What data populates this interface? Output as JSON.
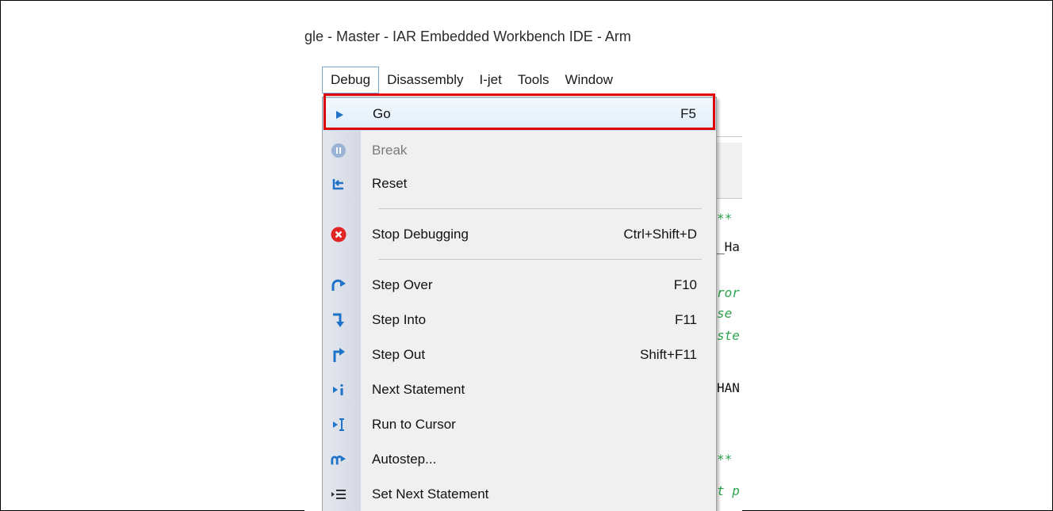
{
  "window": {
    "title": "gle - Master - IAR Embedded Workbench IDE - Arm"
  },
  "menubar": {
    "items": [
      {
        "label": "Debug",
        "active": true
      },
      {
        "label": "Disassembly"
      },
      {
        "label": "I-jet"
      },
      {
        "label": "Tools"
      },
      {
        "label": "Window"
      }
    ]
  },
  "editor_fragments": {
    "f1": "**",
    "f2": "_Ha",
    "f3": "ror",
    "f4": "se",
    "f5": "ste",
    "f6": "HAN",
    "f7": "**",
    "f8": "t p"
  },
  "debug_menu": {
    "go": {
      "label": "Go",
      "shortcut": "F5",
      "icon": "play-icon"
    },
    "break": {
      "label": "Break",
      "icon": "pause-icon"
    },
    "reset": {
      "label": "Reset",
      "icon": "reset-icon"
    },
    "stop": {
      "label": "Stop Debugging",
      "shortcut": "Ctrl+Shift+D",
      "icon": "stop-icon"
    },
    "step_over": {
      "label": "Step Over",
      "shortcut": "F10",
      "icon": "step-over-icon"
    },
    "step_into": {
      "label": "Step Into",
      "shortcut": "F11",
      "icon": "step-into-icon"
    },
    "step_out": {
      "label": "Step Out",
      "shortcut": "Shift+F11",
      "icon": "step-out-icon"
    },
    "next_statement": {
      "label": "Next Statement",
      "icon": "next-statement-icon"
    },
    "run_to_cursor": {
      "label": "Run to Cursor",
      "icon": "run-to-cursor-icon"
    },
    "autostep": {
      "label": "Autostep...",
      "icon": "autostep-icon"
    },
    "set_next_statement": {
      "label": "Set Next Statement",
      "icon": "set-next-statement-icon"
    }
  },
  "colors": {
    "highlight_box": "#e00000",
    "accent_blue": "#1e73c8",
    "stop_red": "#e22"
  }
}
